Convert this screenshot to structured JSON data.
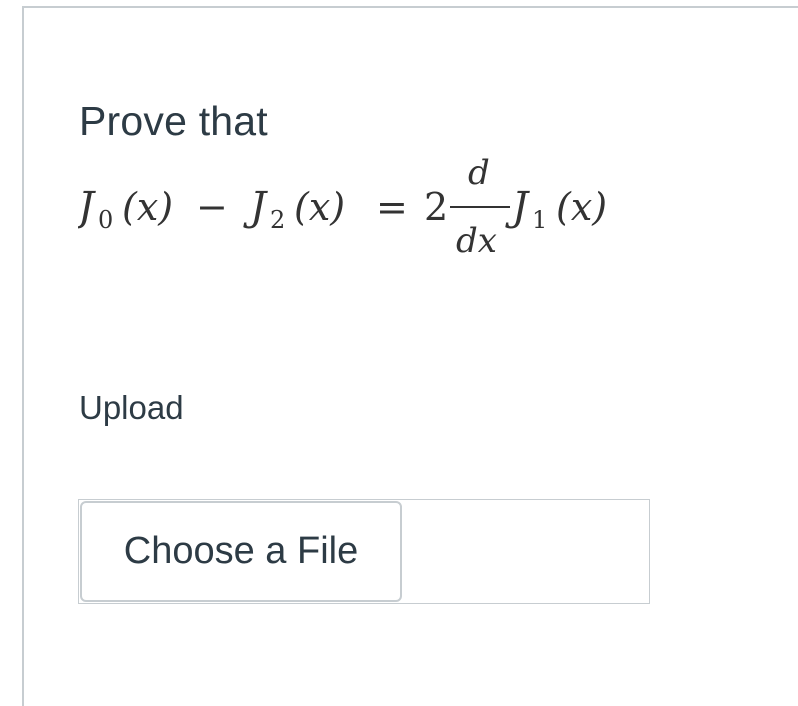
{
  "question": {
    "prompt": "Prove that",
    "equation": {
      "j0": "J",
      "j0_sub": "0",
      "j2": "J",
      "j2_sub": "2",
      "j1": "J",
      "j1_sub": "1",
      "arg": "(x)",
      "minus": "−",
      "equals": "=",
      "coef": "2",
      "frac_num": "d",
      "frac_den": "dx"
    }
  },
  "upload": {
    "label": "Upload",
    "button_label": "Choose a File"
  },
  "colors": {
    "text": "#2d3b45",
    "border": "#c7cdd1"
  }
}
